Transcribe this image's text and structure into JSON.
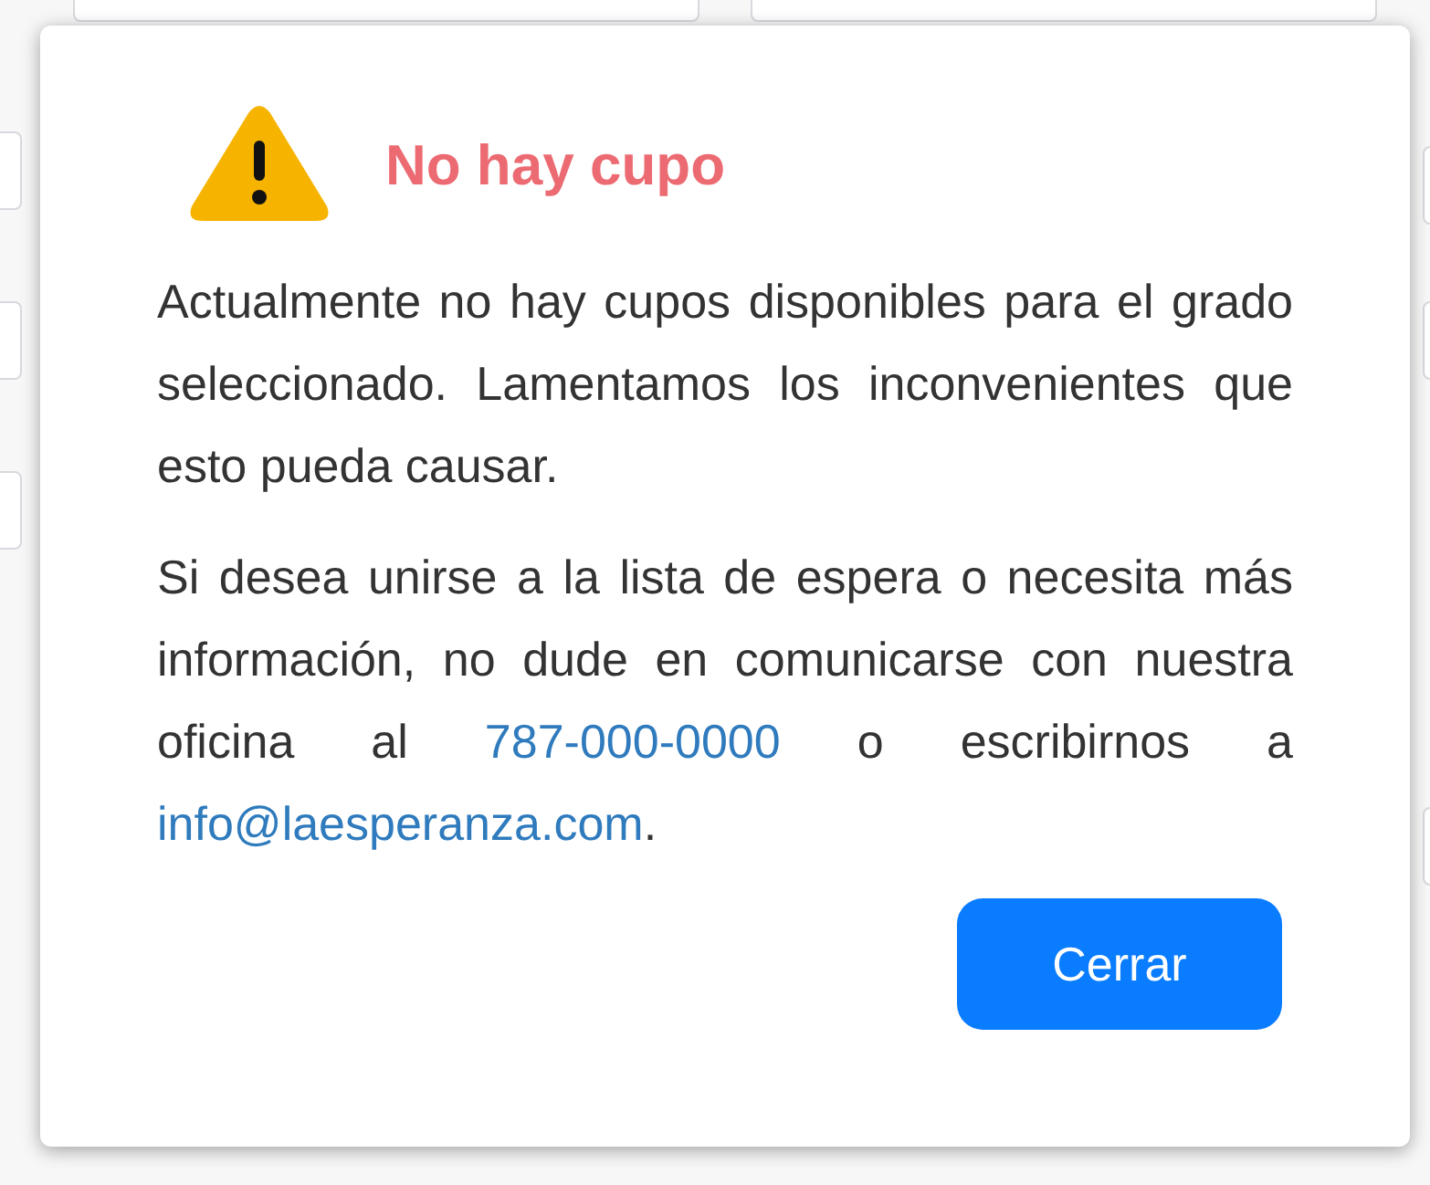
{
  "dialog": {
    "title": "No hay cupo",
    "paragraphs": [
      [
        {
          "kind": "text",
          "text": "Actualmente no hay cupos disponibles para el grado seleccionado. Lamentamos los inconvenientes que esto pueda causar."
        }
      ],
      [
        {
          "kind": "text",
          "text": "Si desea unirse a la lista de espera o necesita más información, no dude en comunicarse con nuestra oficina al "
        },
        {
          "kind": "link",
          "text": "787-000-0000"
        },
        {
          "kind": "text",
          "text": " o escribirnos a "
        },
        {
          "kind": "link",
          "text": "info@laesperanza.com"
        },
        {
          "kind": "text",
          "text": "."
        }
      ]
    ],
    "button": "Cerrar"
  }
}
